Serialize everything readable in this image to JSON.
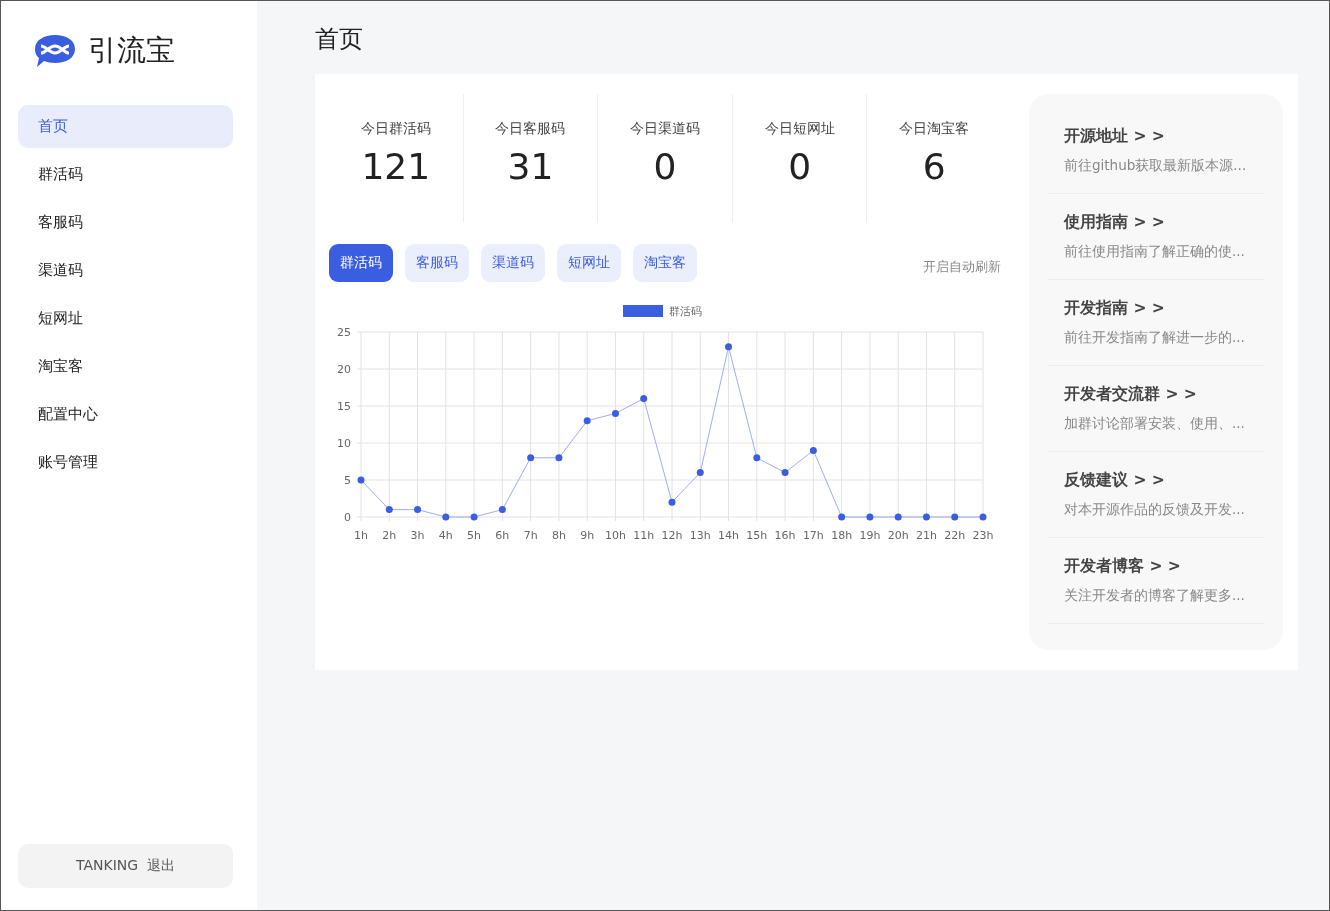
{
  "brand": {
    "name": "引流宝"
  },
  "sidebar": {
    "items": [
      {
        "label": "首页",
        "selected": true
      },
      {
        "label": "群活码",
        "selected": false
      },
      {
        "label": "客服码",
        "selected": false
      },
      {
        "label": "渠道码",
        "selected": false
      },
      {
        "label": "短网址",
        "selected": false
      },
      {
        "label": "淘宝客",
        "selected": false
      },
      {
        "label": "配置中心",
        "selected": false
      },
      {
        "label": "账号管理",
        "selected": false
      }
    ],
    "logout_button": "TANKING  退出"
  },
  "page_title": "首页",
  "stats": [
    {
      "label": "今日群活码",
      "value": "121"
    },
    {
      "label": "今日客服码",
      "value": "31"
    },
    {
      "label": "今日渠道码",
      "value": "0"
    },
    {
      "label": "今日短网址",
      "value": "0"
    },
    {
      "label": "今日淘宝客",
      "value": "6"
    }
  ],
  "chart_tabs": [
    {
      "label": "群活码",
      "selected": true
    },
    {
      "label": "客服码",
      "selected": false
    },
    {
      "label": "渠道码",
      "selected": false
    },
    {
      "label": "短网址",
      "selected": false
    },
    {
      "label": "淘宝客",
      "selected": false
    }
  ],
  "auto_refresh": "开启自动刷新",
  "chart_data": {
    "type": "line",
    "categories": [
      "1h",
      "2h",
      "3h",
      "4h",
      "5h",
      "6h",
      "7h",
      "8h",
      "9h",
      "10h",
      "11h",
      "12h",
      "13h",
      "14h",
      "15h",
      "16h",
      "17h",
      "18h",
      "19h",
      "20h",
      "21h",
      "22h",
      "23h"
    ],
    "grid": true,
    "series": [
      {
        "name": "群活码",
        "color": "#3b5ee0",
        "marker": "circle",
        "values": [
          5,
          1,
          1,
          0,
          0,
          1,
          8,
          8,
          13,
          14,
          16,
          2,
          6,
          23,
          8,
          6,
          9,
          0,
          0,
          0,
          0,
          0,
          0
        ]
      }
    ],
    "ylim": [
      0,
      25
    ],
    "yticks": [
      0,
      5,
      10,
      15,
      20,
      25
    ]
  },
  "links": [
    {
      "title": "开源地址",
      "arrow": "> >",
      "description": "前往github获取最新版本源..."
    },
    {
      "title": "使用指南",
      "arrow": "> >",
      "description": "前往使用指南了解正确的使..."
    },
    {
      "title": "开发指南",
      "arrow": "> >",
      "description": "前往开发指南了解进一步的..."
    },
    {
      "title": "开发者交流群",
      "arrow": "> >",
      "description": "加群讨论部署安装、使用、..."
    },
    {
      "title": "反馈建议",
      "arrow": "> >",
      "description": "对本开源作品的反馈及开发..."
    },
    {
      "title": "开发者博客",
      "arrow": "> >",
      "description": "关注开发者的博客了解更多..."
    }
  ]
}
